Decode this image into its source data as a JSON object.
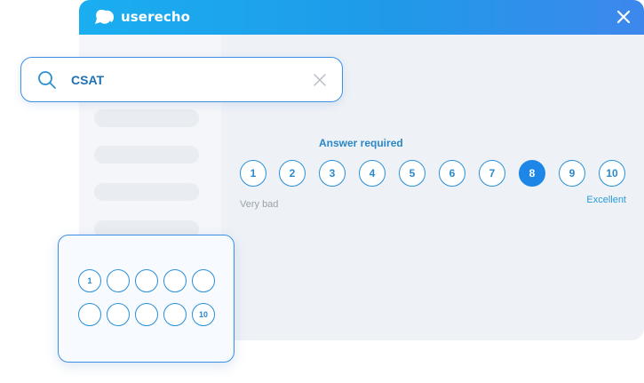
{
  "app": {
    "title": "userecho",
    "logo_icon": "userecho-logo-icon",
    "close_icon": "close-icon"
  },
  "colors": {
    "accent": "#1e86e6",
    "header_start": "#1aaef0",
    "header_end": "#3d87ec",
    "label_blue": "#2b86c5"
  },
  "search": {
    "value": "CSAT",
    "icon": "search-icon",
    "clear_icon": "clear-icon"
  },
  "question": {
    "required_label": "Answer required",
    "scale": [
      "1",
      "2",
      "3",
      "4",
      "5",
      "6",
      "7",
      "8",
      "9",
      "10"
    ],
    "selected": "8",
    "low_label": "Very bad",
    "high_label": "Excellent"
  },
  "widget": {
    "row1": [
      "1",
      "",
      "",
      "",
      ""
    ],
    "row2": [
      "",
      "",
      "",
      "",
      "10"
    ]
  }
}
